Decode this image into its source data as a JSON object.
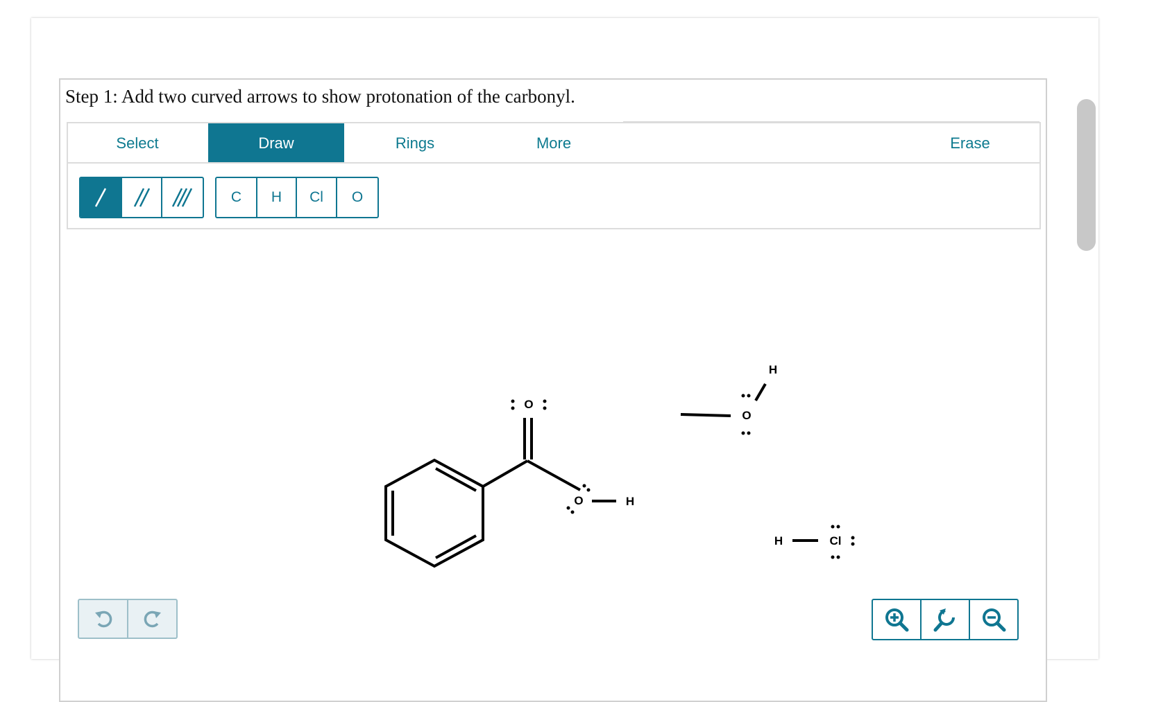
{
  "step": {
    "title": "Step 1: Add two curved arrows to show protonation of the carbonyl."
  },
  "tabs": [
    {
      "label": "Select",
      "active": false
    },
    {
      "label": "Draw",
      "active": true
    },
    {
      "label": "Rings",
      "active": false
    },
    {
      "label": "More",
      "active": false
    },
    {
      "label": "Erase",
      "active": false
    }
  ],
  "bonds": {
    "selected": "single",
    "options": [
      "single",
      "double",
      "triple"
    ]
  },
  "atoms": [
    "C",
    "H",
    "Cl",
    "O"
  ],
  "molecules": {
    "carbonyl_oxygen": "O",
    "ester_oxygen": "O",
    "ester_hydrogen": "H",
    "ethanol_oxygen": "O",
    "ethanol_hydrogen": "H",
    "hcl_hydrogen": "H",
    "hcl_chlorine": "Cl"
  },
  "icons": {
    "undo": "undo-icon",
    "redo": "redo-icon",
    "zoom_in": "zoom-in-icon",
    "zoom_reset": "zoom-reset-icon",
    "zoom_out": "zoom-out-icon"
  },
  "colors": {
    "accent": "#0f7691",
    "text_accent": "#0d7a8f"
  }
}
